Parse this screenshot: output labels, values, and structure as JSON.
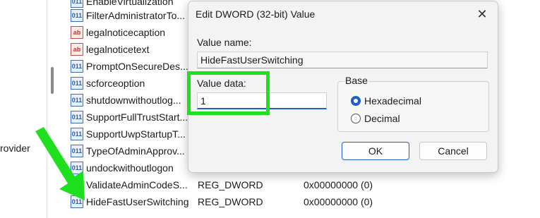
{
  "left_pane": {
    "provider_text": "rovider"
  },
  "registry_rows": [
    {
      "name": "EnableVirtualization",
      "type": "",
      "data": "",
      "icon": "binary-value-icon"
    },
    {
      "name": "FilterAdministratorTo...",
      "type": "",
      "data": "",
      "icon": "binary-value-icon"
    },
    {
      "name": "legalnoticecaption",
      "type": "",
      "data": "",
      "icon": "string-value-icon"
    },
    {
      "name": "legalnoticetext",
      "type": "",
      "data": "",
      "icon": "string-value-icon"
    },
    {
      "name": "PromptOnSecureDes...",
      "type": "",
      "data": "",
      "icon": "binary-value-icon"
    },
    {
      "name": "scforceoption",
      "type": "",
      "data": "",
      "icon": "binary-value-icon"
    },
    {
      "name": "shutdownwithoutlog...",
      "type": "",
      "data": "",
      "icon": "binary-value-icon"
    },
    {
      "name": "SupportFullTrustStart...",
      "type": "",
      "data": "",
      "icon": "binary-value-icon"
    },
    {
      "name": "SupportUwpStartupT...",
      "type": "",
      "data": "",
      "icon": "binary-value-icon"
    },
    {
      "name": "TypeOfAdminApprov...",
      "type": "",
      "data": "",
      "icon": "binary-value-icon"
    },
    {
      "name": "undockwithoutlogon",
      "type": "",
      "data": "",
      "icon": "binary-value-icon"
    },
    {
      "name": "ValidateAdminCodeS...",
      "type": "REG_DWORD",
      "data": "0x00000000 (0)",
      "icon": "binary-value-icon"
    },
    {
      "name": "HideFastUserSwitching",
      "type": "REG_DWORD",
      "data": "0x00000000 (0)",
      "icon": "binary-value-icon"
    }
  ],
  "dialog": {
    "title": "Edit DWORD (32-bit) Value",
    "close_glyph": "✕",
    "value_name_label": "Value name:",
    "value_name": "HideFastUserSwitching",
    "value_data_label": "Value data:",
    "value_data": "1",
    "base_label": "Base",
    "base_options": [
      "Hexadecimal",
      "Decimal"
    ],
    "base_selected": "Hexadecimal",
    "ok_label": "OK",
    "cancel_label": "Cancel"
  },
  "icon_glyphs": {
    "binary": "011",
    "string": "ab"
  },
  "colors": {
    "highlight": "#1ee01e",
    "accent": "#1f5fbf"
  }
}
